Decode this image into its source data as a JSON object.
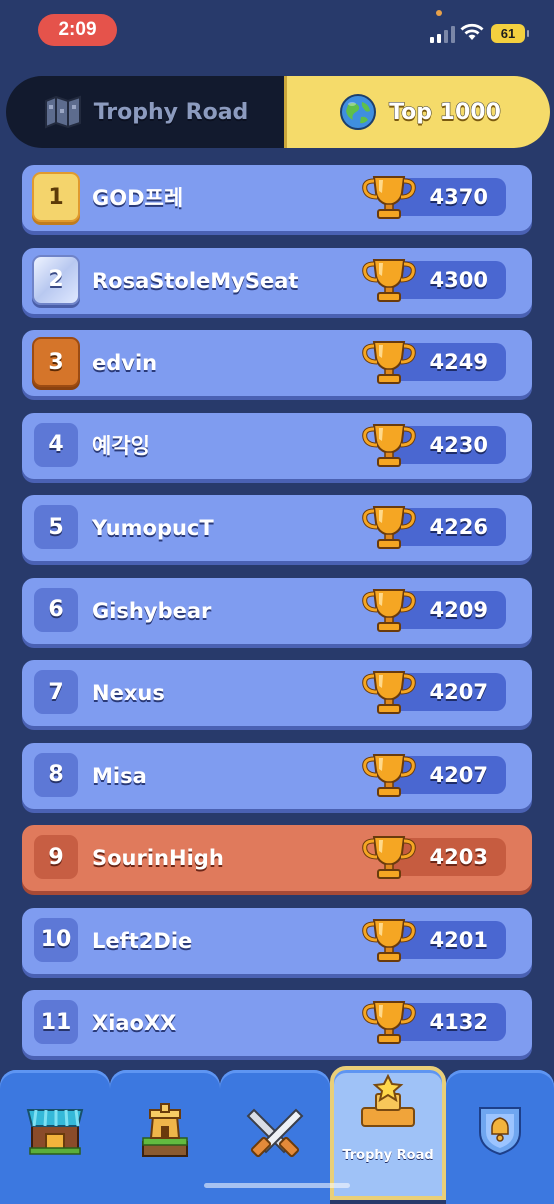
{
  "status_bar": {
    "time": "2:09",
    "battery": "61"
  },
  "tabs": [
    {
      "label": "Trophy Road",
      "icon": "trophy-road-map-icon",
      "active": false
    },
    {
      "label": "Top 1000",
      "icon": "globe-icon",
      "active": true
    }
  ],
  "leaderboard": [
    {
      "rank": "1",
      "name": "GOD프레",
      "score": "4370",
      "rank_style": "gold"
    },
    {
      "rank": "2",
      "name": "RosaStoleMySeat",
      "score": "4300",
      "rank_style": "silver"
    },
    {
      "rank": "3",
      "name": "edvin",
      "score": "4249",
      "rank_style": "bronze"
    },
    {
      "rank": "4",
      "name": "예각잉",
      "score": "4230",
      "rank_style": "plain"
    },
    {
      "rank": "5",
      "name": "YumopucT",
      "score": "4226",
      "rank_style": "plain"
    },
    {
      "rank": "6",
      "name": "Gishybear",
      "score": "4209",
      "rank_style": "plain"
    },
    {
      "rank": "7",
      "name": "Nexus",
      "score": "4207",
      "rank_style": "plain"
    },
    {
      "rank": "8",
      "name": "Misa",
      "score": "4207",
      "rank_style": "plain"
    },
    {
      "rank": "9",
      "name": "SourinHigh",
      "score": "4203",
      "rank_style": "highlight"
    },
    {
      "rank": "10",
      "name": "Left2Die",
      "score": "4201",
      "rank_style": "plain"
    },
    {
      "rank": "11",
      "name": "XiaoXX",
      "score": "4132",
      "rank_style": "plain"
    }
  ],
  "bottom_nav": [
    {
      "icon": "shop-icon",
      "label": ""
    },
    {
      "icon": "battle-tower-icon",
      "label": ""
    },
    {
      "icon": "crossed-swords-icon",
      "label": ""
    },
    {
      "icon": "trophy-podium-icon",
      "label": "Trophy Road",
      "active": true
    },
    {
      "icon": "clan-shield-icon",
      "label": ""
    }
  ],
  "colors": {
    "background": "#283a6b",
    "row": "#7f9cf0",
    "row_highlight": "#e07a5c",
    "active_tab": "#f5db6a",
    "nav": "#3c78e0"
  }
}
